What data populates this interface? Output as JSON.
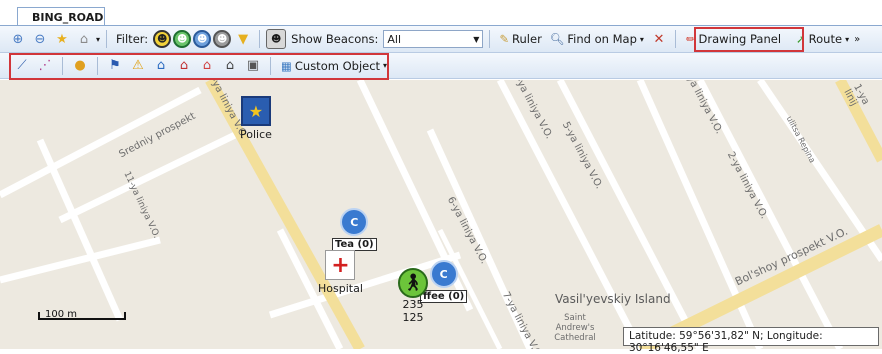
{
  "tab": {
    "label": "BING_ROAD"
  },
  "toolbar": {
    "filter_label": "Filter:",
    "beacons_label": "Show Beacons:",
    "beacons_value": "All",
    "ruler_label": "Ruler",
    "find_label": "Find on Map",
    "drawing_panel_label": "Drawing Panel",
    "route_label": "Route"
  },
  "drawing_toolbar": {
    "custom_object_label": "Custom Object"
  },
  "map": {
    "streets": [
      "Sredniy prospekt",
      "1-ya liniya V.O.",
      "6-ya liniya V.O.",
      "7-ya liniya V.O.",
      "5-ya liniya V.O.",
      "4-ya liniya V.O.",
      "2-ya liniya V.O.",
      "3-ya liniya V.O.",
      "1-ya linij",
      "Bol'shoy prospekt V.O.",
      "ulitsa Repina",
      "11-ya liniya V.O."
    ],
    "area_label": "Vasil'yevskiy Island",
    "church_label": "Saint Andrew's Cathedral",
    "poi": {
      "police": "Police",
      "hospital": "Hospital",
      "tea": "Tea (0)",
      "coffee": "ffee (0)",
      "unit_line1": "235",
      "unit_line2": "125"
    },
    "scale_label": "100 m",
    "coordinates": "Latitude: 59°56'31,82\" N; Longitude: 30°16'46,55\" E"
  }
}
